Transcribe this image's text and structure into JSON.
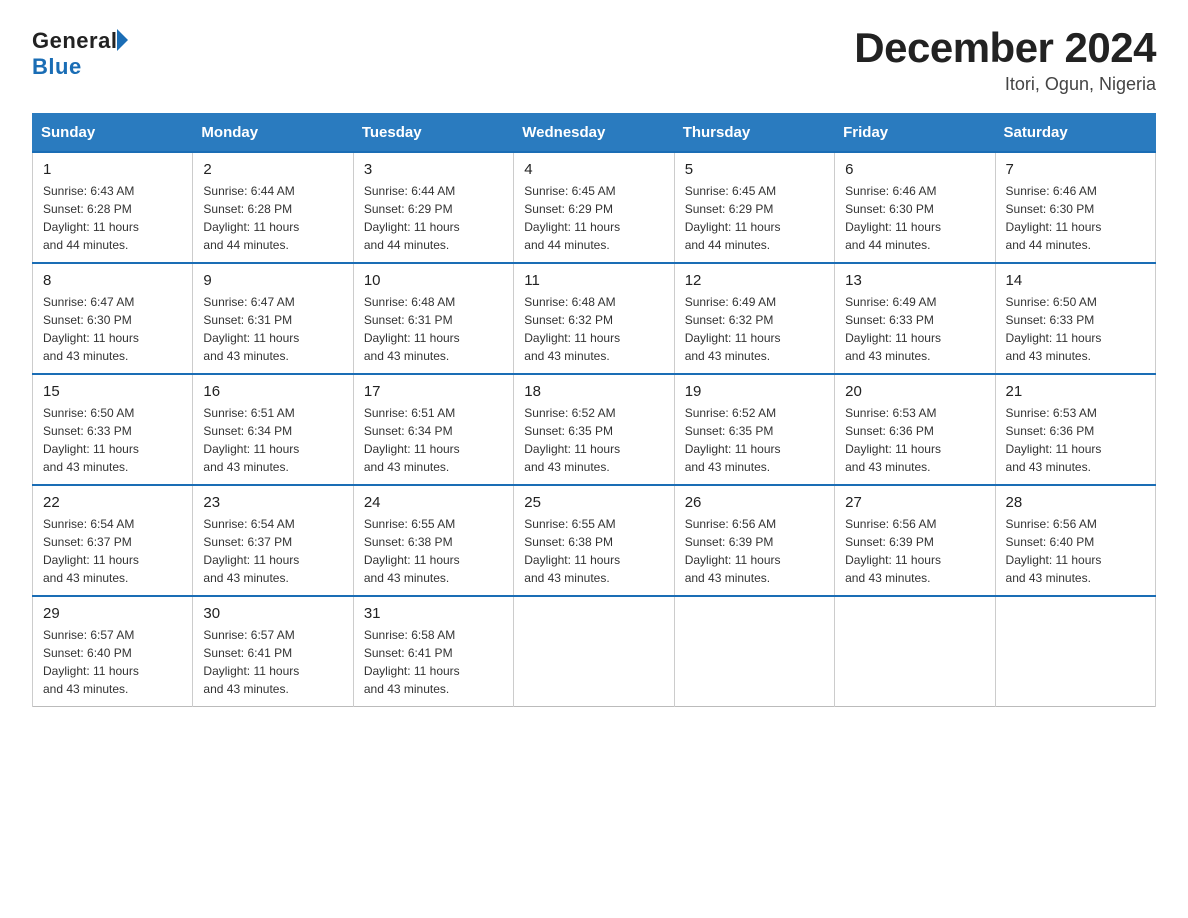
{
  "header": {
    "logo_general": "General",
    "logo_blue": "Blue",
    "title": "December 2024",
    "subtitle": "Itori, Ogun, Nigeria"
  },
  "days_of_week": [
    "Sunday",
    "Monday",
    "Tuesday",
    "Wednesday",
    "Thursday",
    "Friday",
    "Saturday"
  ],
  "weeks": [
    [
      {
        "day": "1",
        "sunrise": "6:43 AM",
        "sunset": "6:28 PM",
        "daylight": "11 hours and 44 minutes."
      },
      {
        "day": "2",
        "sunrise": "6:44 AM",
        "sunset": "6:28 PM",
        "daylight": "11 hours and 44 minutes."
      },
      {
        "day": "3",
        "sunrise": "6:44 AM",
        "sunset": "6:29 PM",
        "daylight": "11 hours and 44 minutes."
      },
      {
        "day": "4",
        "sunrise": "6:45 AM",
        "sunset": "6:29 PM",
        "daylight": "11 hours and 44 minutes."
      },
      {
        "day": "5",
        "sunrise": "6:45 AM",
        "sunset": "6:29 PM",
        "daylight": "11 hours and 44 minutes."
      },
      {
        "day": "6",
        "sunrise": "6:46 AM",
        "sunset": "6:30 PM",
        "daylight": "11 hours and 44 minutes."
      },
      {
        "day": "7",
        "sunrise": "6:46 AM",
        "sunset": "6:30 PM",
        "daylight": "11 hours and 44 minutes."
      }
    ],
    [
      {
        "day": "8",
        "sunrise": "6:47 AM",
        "sunset": "6:30 PM",
        "daylight": "11 hours and 43 minutes."
      },
      {
        "day": "9",
        "sunrise": "6:47 AM",
        "sunset": "6:31 PM",
        "daylight": "11 hours and 43 minutes."
      },
      {
        "day": "10",
        "sunrise": "6:48 AM",
        "sunset": "6:31 PM",
        "daylight": "11 hours and 43 minutes."
      },
      {
        "day": "11",
        "sunrise": "6:48 AM",
        "sunset": "6:32 PM",
        "daylight": "11 hours and 43 minutes."
      },
      {
        "day": "12",
        "sunrise": "6:49 AM",
        "sunset": "6:32 PM",
        "daylight": "11 hours and 43 minutes."
      },
      {
        "day": "13",
        "sunrise": "6:49 AM",
        "sunset": "6:33 PM",
        "daylight": "11 hours and 43 minutes."
      },
      {
        "day": "14",
        "sunrise": "6:50 AM",
        "sunset": "6:33 PM",
        "daylight": "11 hours and 43 minutes."
      }
    ],
    [
      {
        "day": "15",
        "sunrise": "6:50 AM",
        "sunset": "6:33 PM",
        "daylight": "11 hours and 43 minutes."
      },
      {
        "day": "16",
        "sunrise": "6:51 AM",
        "sunset": "6:34 PM",
        "daylight": "11 hours and 43 minutes."
      },
      {
        "day": "17",
        "sunrise": "6:51 AM",
        "sunset": "6:34 PM",
        "daylight": "11 hours and 43 minutes."
      },
      {
        "day": "18",
        "sunrise": "6:52 AM",
        "sunset": "6:35 PM",
        "daylight": "11 hours and 43 minutes."
      },
      {
        "day": "19",
        "sunrise": "6:52 AM",
        "sunset": "6:35 PM",
        "daylight": "11 hours and 43 minutes."
      },
      {
        "day": "20",
        "sunrise": "6:53 AM",
        "sunset": "6:36 PM",
        "daylight": "11 hours and 43 minutes."
      },
      {
        "day": "21",
        "sunrise": "6:53 AM",
        "sunset": "6:36 PM",
        "daylight": "11 hours and 43 minutes."
      }
    ],
    [
      {
        "day": "22",
        "sunrise": "6:54 AM",
        "sunset": "6:37 PM",
        "daylight": "11 hours and 43 minutes."
      },
      {
        "day": "23",
        "sunrise": "6:54 AM",
        "sunset": "6:37 PM",
        "daylight": "11 hours and 43 minutes."
      },
      {
        "day": "24",
        "sunrise": "6:55 AM",
        "sunset": "6:38 PM",
        "daylight": "11 hours and 43 minutes."
      },
      {
        "day": "25",
        "sunrise": "6:55 AM",
        "sunset": "6:38 PM",
        "daylight": "11 hours and 43 minutes."
      },
      {
        "day": "26",
        "sunrise": "6:56 AM",
        "sunset": "6:39 PM",
        "daylight": "11 hours and 43 minutes."
      },
      {
        "day": "27",
        "sunrise": "6:56 AM",
        "sunset": "6:39 PM",
        "daylight": "11 hours and 43 minutes."
      },
      {
        "day": "28",
        "sunrise": "6:56 AM",
        "sunset": "6:40 PM",
        "daylight": "11 hours and 43 minutes."
      }
    ],
    [
      {
        "day": "29",
        "sunrise": "6:57 AM",
        "sunset": "6:40 PM",
        "daylight": "11 hours and 43 minutes."
      },
      {
        "day": "30",
        "sunrise": "6:57 AM",
        "sunset": "6:41 PM",
        "daylight": "11 hours and 43 minutes."
      },
      {
        "day": "31",
        "sunrise": "6:58 AM",
        "sunset": "6:41 PM",
        "daylight": "11 hours and 43 minutes."
      },
      null,
      null,
      null,
      null
    ]
  ],
  "labels": {
    "sunrise": "Sunrise:",
    "sunset": "Sunset:",
    "daylight": "Daylight:"
  }
}
